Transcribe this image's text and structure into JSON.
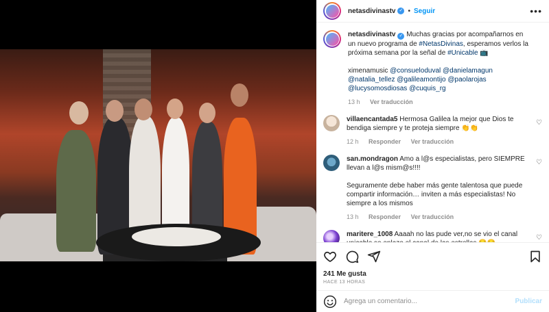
{
  "post": {
    "username": "netasdivinastv",
    "follow_label": "Seguir",
    "separator": "•",
    "more_label": "•••"
  },
  "caption": {
    "username": "netasdivinastv",
    "text_1": "Muchas gracias por acompañarnos en un nuevo programa de ",
    "hashtag_1": "#NetasDivinas",
    "text_2": ", esperamos verlos la próxima semana por la señal de ",
    "hashtag_2": "#Unicable",
    "text_3": " 📺",
    "credits_prefix": "ximenamusic ",
    "credits_tags": "@consueloduval @danielamagun @natalia_tellez @galileamontijo @paolarojas @lucysomosdiosas @cuquis_rg",
    "time": "13 h",
    "translate": "Ver traducción"
  },
  "comments": [
    {
      "username": "villaencantada5",
      "text": "Hermosa Galilea la mejor que Dios te bendiga siempre y te proteja siempre 👏👏",
      "time": "12 h",
      "reply": "Responder",
      "translate": "Ver traducción"
    },
    {
      "username": "san.mondragon",
      "text": "Amo a l@s especialistas, pero SIEMPRE llevan a l@s mism@s!!!!",
      "text_2": "Seguramente debe haber más gente talentosa que puede compartir información… inviten a más especialistas! No siempre a los mismos",
      "time": "13 h",
      "reply": "Responder",
      "translate": "Ver traducción"
    },
    {
      "username": "maritere_1008",
      "text": "Aaaah no las pude ver,no se vio el canal unicable se enlazo el canal de las estrellas 😔😔"
    }
  ],
  "actions": {
    "likes": "241 Me gusta",
    "ago": "HACE 13 HORAS"
  },
  "add_comment": {
    "placeholder": "Agrega un comentario...",
    "post_label": "Publicar"
  },
  "icons": {
    "verified": "✓",
    "heart": "♡"
  },
  "colors": {
    "link": "#00376b",
    "follow": "#0095f6",
    "verified": "#3897f0",
    "post_disabled": "#b2dffc"
  }
}
